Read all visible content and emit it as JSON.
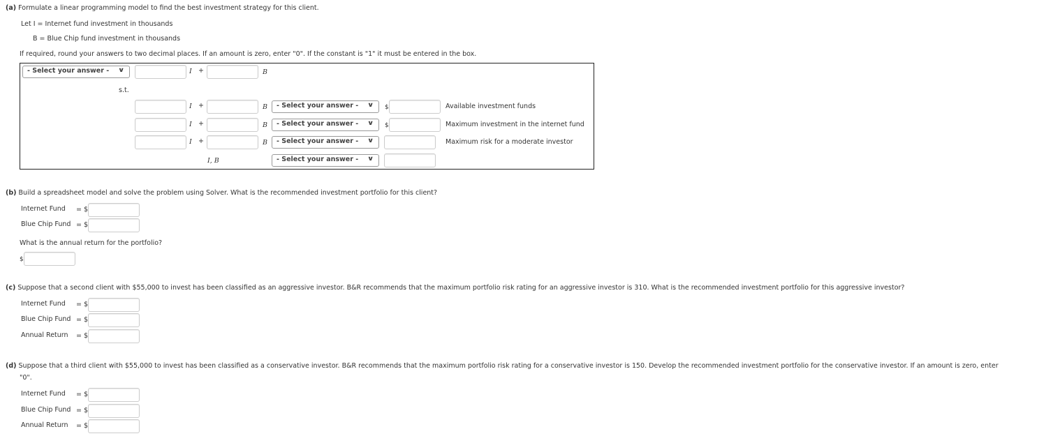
{
  "part_a": {
    "label": "(a)",
    "question": "Formulate a linear programming model to find the best investment strategy for this client.",
    "let_I": "Let I = Internet fund investment in thousands",
    "let_B": "B = Blue Chip fund investment in thousands",
    "instructions": "If required, round your answers to two decimal places. If an amount is zero, enter \"0\". If the constant is \"1\" it must be entered in the box.",
    "select_placeholder": "- Select your answer -",
    "var_I": "I",
    "var_B": "B",
    "plus": "+",
    "st": "s.t.",
    "nonneg_vars": "I, B",
    "dollar": "$",
    "constraints": [
      {
        "label": "Available investment funds",
        "has_dollar": true
      },
      {
        "label": "Maximum investment in the internet fund",
        "has_dollar": true
      },
      {
        "label": "Maximum risk for a moderate investor",
        "has_dollar": false
      }
    ]
  },
  "part_b": {
    "label": "(b)",
    "question": "Build a spreadsheet model and solve the problem using Solver. What is the recommended investment portfolio for this client?",
    "internet_fund": "Internet Fund",
    "blue_chip_fund": "Blue Chip Fund",
    "eq_dollar": "= $",
    "annual_question": "What is the annual return for the portfolio?",
    "dollar": "$"
  },
  "part_c": {
    "label": "(c)",
    "question": "Suppose that a second client with $55,000 to invest has been classified as an aggressive investor. B&R recommends that the maximum portfolio risk rating for an aggressive investor is 310. What is the recommended investment portfolio for this aggressive investor?",
    "internet_fund": "Internet Fund",
    "blue_chip_fund": "Blue Chip Fund",
    "annual_return": "Annual Return",
    "eq_dollar": "= $"
  },
  "part_d": {
    "label": "(d)",
    "question": "Suppose that a third client with $55,000 to invest has been classified as a conservative investor. B&R recommends that the maximum portfolio risk rating for a conservative investor is 150. Develop the recommended investment portfolio for the conservative investor. If an amount is zero, enter",
    "question_cont": "\"0\".",
    "internet_fund": "Internet Fund",
    "blue_chip_fund": "Blue Chip Fund",
    "annual_return": "Annual Return",
    "eq_dollar": "= $"
  }
}
